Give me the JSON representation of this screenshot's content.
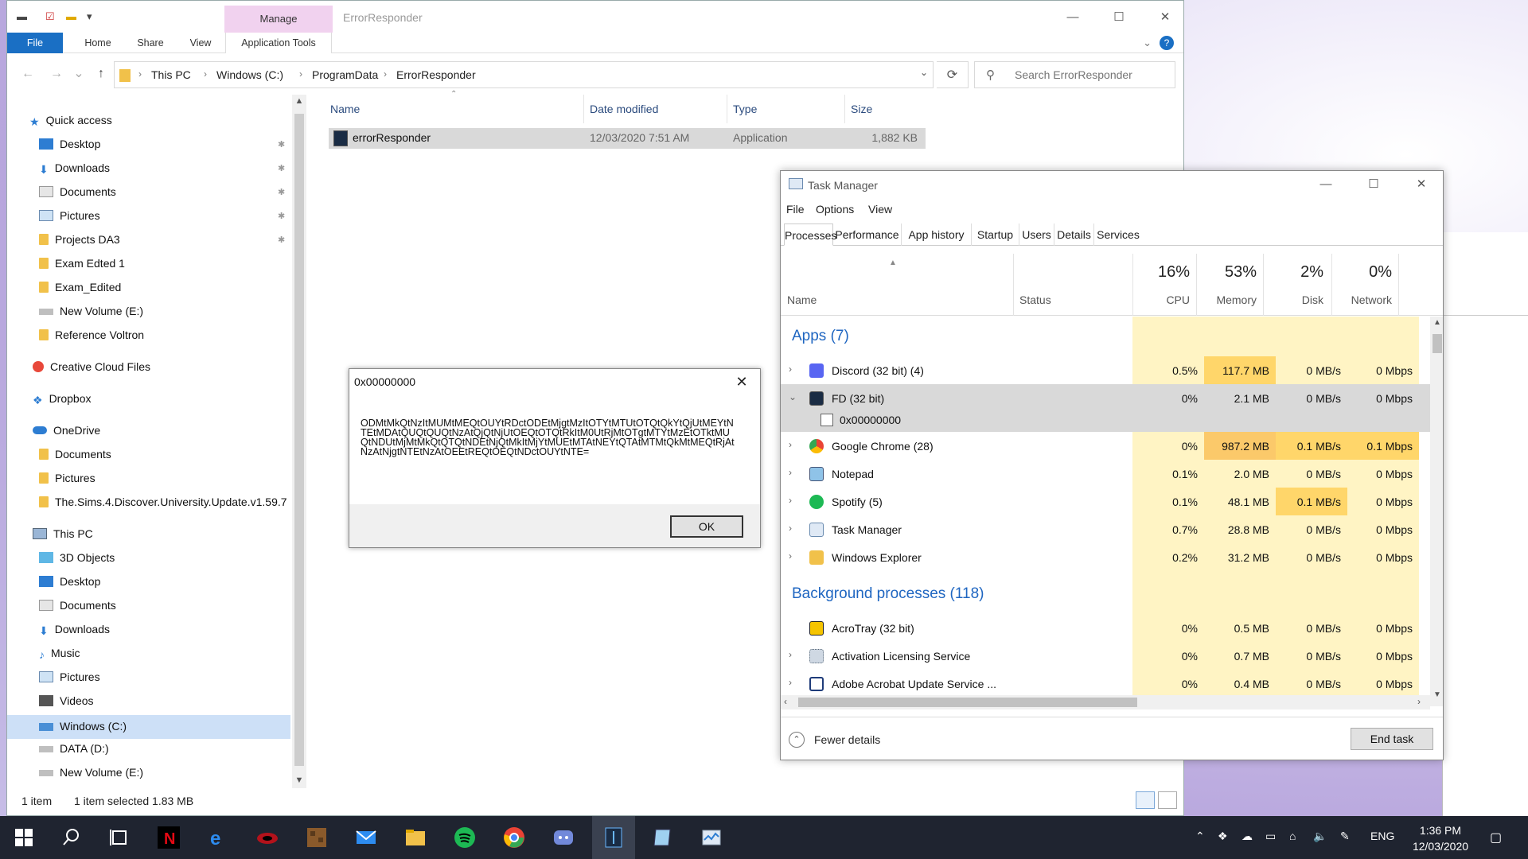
{
  "explorer": {
    "window_title": "ErrorResponder",
    "ribbon": {
      "manage": "Manage",
      "tabs": [
        "File",
        "Home",
        "Share",
        "View"
      ],
      "app_tools": "Application Tools"
    },
    "breadcrumb": [
      "This PC",
      "Windows (C:)",
      "ProgramData",
      "ErrorResponder"
    ],
    "search_placeholder": "Search ErrorResponder",
    "nav": {
      "quick_access": "Quick access",
      "qa_items": [
        "Desktop",
        "Downloads",
        "Documents",
        "Pictures",
        "Projects DA3",
        "Exam Edted 1",
        "Exam_Edited",
        "New Volume (E:)",
        "Reference Voltron"
      ],
      "creative_cloud": "Creative Cloud Files",
      "dropbox": "Dropbox",
      "onedrive": "OneDrive",
      "onedrive_items": [
        "Documents",
        "Pictures",
        "The.Sims.4.Discover.University.Update.v1.59.7"
      ],
      "this_pc": "This PC",
      "pc_items": [
        "3D Objects",
        "Desktop",
        "Documents",
        "Downloads",
        "Music",
        "Pictures",
        "Videos",
        "Windows (C:)",
        "DATA (D:)",
        "New Volume (E:)"
      ]
    },
    "columns": [
      "Name",
      "Date modified",
      "Type",
      "Size"
    ],
    "file": {
      "name": "errorResponder",
      "date": "12/03/2020 7:51 AM",
      "type": "Application",
      "size": "1,882 KB"
    },
    "status": {
      "count": "1 item",
      "selected": "1 item selected  1.83 MB"
    }
  },
  "dialog": {
    "title": "0x00000000",
    "message": "ODMtMkQtNzItMUMtMEQtOUYtRDctODEtMjgtMzItOTYtMTUtOTQtQkYtQjUtMEYtNTEtMDAtQUQtQUQtNzAtQjQtNjUtOEQtOTQtRkItM0UtRjMtOTgtMTYtMzEtOTktMUQtNDUtMjMtMkQtQTQtNDEtNjQtMkItMjYtMUEtMTAtNEYtQTAtMTMtQkMtMEQtRjAtNzAtNjgtNTEtNzAtOEEtREQtOEQtNDctOUYtNTE=",
    "ok": "OK"
  },
  "taskmanager": {
    "title": "Task Manager",
    "menu": [
      "File",
      "Options",
      "View"
    ],
    "tabs": [
      "Processes",
      "Performance",
      "App history",
      "Startup",
      "Users",
      "Details",
      "Services"
    ],
    "header": {
      "name": "Name",
      "status": "Status",
      "cpu_pct": "16%",
      "cpu": "CPU",
      "mem_pct": "53%",
      "mem": "Memory",
      "disk_pct": "2%",
      "disk": "Disk",
      "net_pct": "0%",
      "net": "Network"
    },
    "apps_group": "Apps (7)",
    "apps": [
      {
        "name": "Discord (32 bit) (4)",
        "cpu": "0.5%",
        "mem": "117.7 MB",
        "disk": "0 MB/s",
        "net": "0 Mbps"
      },
      {
        "name": "FD (32 bit)",
        "cpu": "0%",
        "mem": "2.1 MB",
        "disk": "0 MB/s",
        "net": "0 Mbps"
      },
      {
        "name": "Google Chrome (28)",
        "cpu": "0%",
        "mem": "987.2 MB",
        "disk": "0.1 MB/s",
        "net": "0.1 Mbps"
      },
      {
        "name": "Notepad",
        "cpu": "0.1%",
        "mem": "2.0 MB",
        "disk": "0 MB/s",
        "net": "0 Mbps"
      },
      {
        "name": "Spotify (5)",
        "cpu": "0.1%",
        "mem": "48.1 MB",
        "disk": "0.1 MB/s",
        "net": "0 Mbps"
      },
      {
        "name": "Task Manager",
        "cpu": "0.7%",
        "mem": "28.8 MB",
        "disk": "0 MB/s",
        "net": "0 Mbps"
      },
      {
        "name": "Windows Explorer",
        "cpu": "0.2%",
        "mem": "31.2 MB",
        "disk": "0 MB/s",
        "net": "0 Mbps"
      }
    ],
    "fd_child": "0x00000000",
    "bg_group": "Background processes (118)",
    "bg": [
      {
        "name": "AcroTray (32 bit)",
        "cpu": "0%",
        "mem": "0.5 MB",
        "disk": "0 MB/s",
        "net": "0 Mbps"
      },
      {
        "name": "Activation Licensing Service",
        "cpu": "0%",
        "mem": "0.7 MB",
        "disk": "0 MB/s",
        "net": "0 Mbps"
      },
      {
        "name": "Adobe Acrobat Update Service ...",
        "cpu": "0%",
        "mem": "0.4 MB",
        "disk": "0 MB/s",
        "net": "0 Mbps"
      }
    ],
    "fewer_details": "Fewer details",
    "end_task": "End task"
  },
  "taskbar": {
    "lang": "ENG",
    "time": "1:36 PM",
    "date": "12/03/2020"
  }
}
